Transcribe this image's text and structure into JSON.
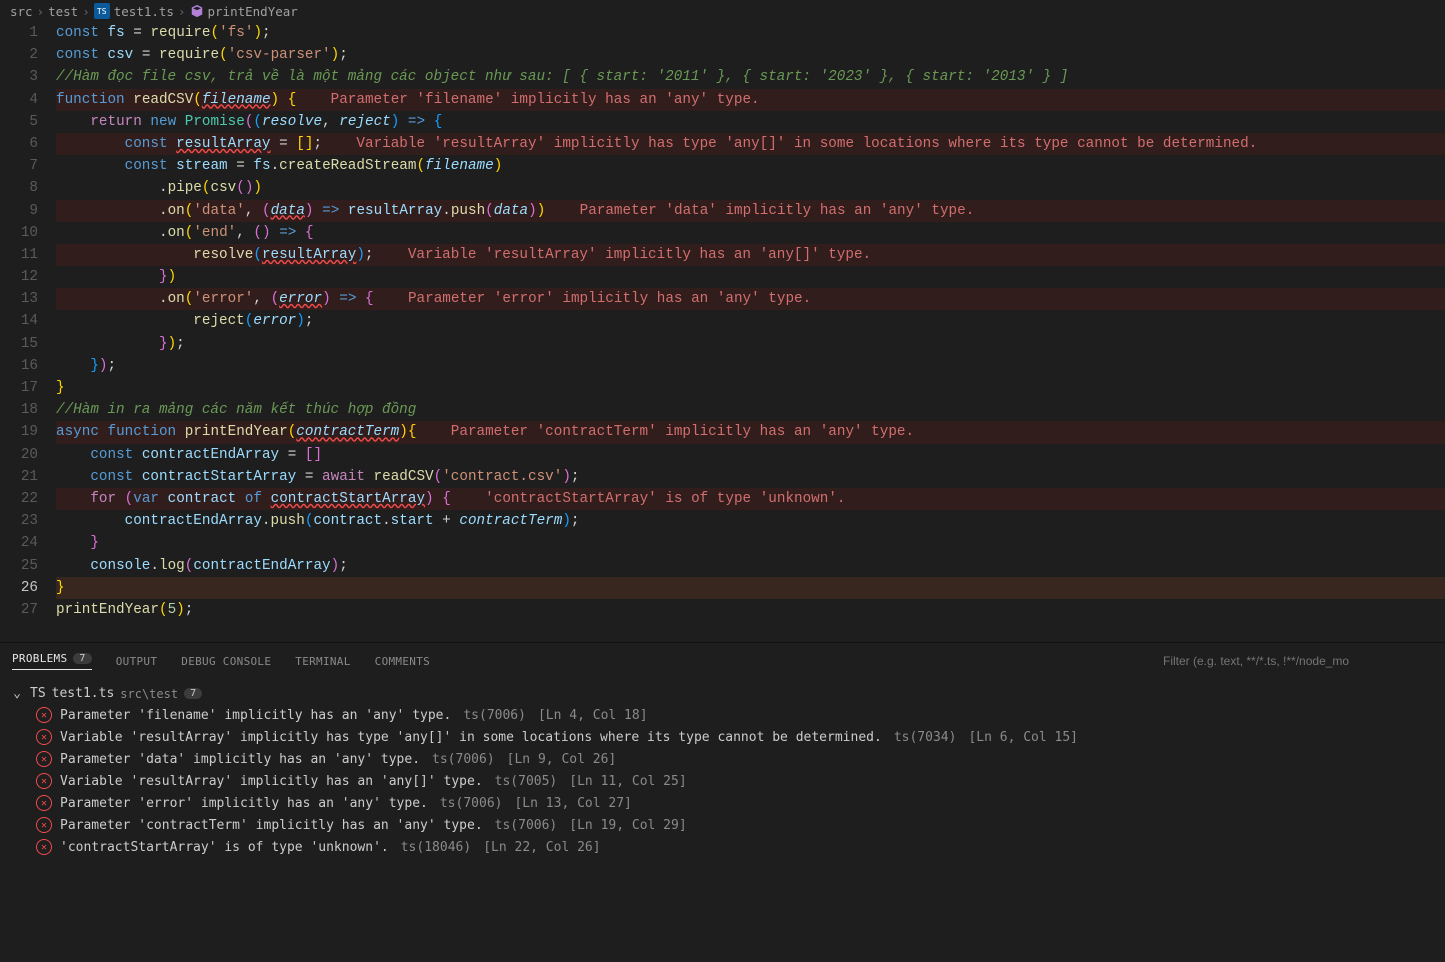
{
  "breadcrumb": {
    "parts": [
      "src",
      "test",
      "test1.ts",
      "printEndYear"
    ]
  },
  "editor": {
    "active_line": 26,
    "lines": [
      {
        "n": 1,
        "err": false,
        "html": "<span class='kw'>const</span> <span class='var'>fs</span> <span class='op'>=</span> <span class='fn'>require</span><span class='brace'>(</span><span class='str'>'fs'</span><span class='brace'>)</span><span class='punc'>;</span>"
      },
      {
        "n": 2,
        "err": false,
        "html": "<span class='kw'>const</span> <span class='var'>csv</span> <span class='op'>=</span> <span class='fn'>require</span><span class='brace'>(</span><span class='str'>'csv-parser'</span><span class='brace'>)</span><span class='punc'>;</span>"
      },
      {
        "n": 3,
        "err": false,
        "html": "<span class='cm'>//Hàm đọc file csv, trả về là một mảng các object như sau: [ { start: '2011' }, { start: '2023' }, { start: '2013' } ]</span>"
      },
      {
        "n": 4,
        "err": true,
        "html": "<span class='kw'>function</span> <span class='fn'>readCSV</span><span class='brace'>(</span><span class='param squig'>filename</span><span class='brace'>)</span> <span class='brace'>{</span>    <span class='hint'>Parameter 'filename' implicitly has an 'any' type.</span>"
      },
      {
        "n": 5,
        "err": false,
        "html": "    <span class='kw2'>return</span> <span class='kw'>new</span> <span class='cls'>Promise</span><span class='brace2'>(</span><span class='brace3'>(</span><span class='param'>resolve</span><span class='punc'>,</span> <span class='param'>reject</span><span class='brace3'>)</span> <span class='kw'>=&gt;</span> <span class='brace3'>{</span>"
      },
      {
        "n": 6,
        "err": true,
        "html": "        <span class='kw'>const</span> <span class='var squig'>resultArray</span> <span class='op'>=</span> <span class='brace'>[</span><span class='brace'>]</span><span class='punc'>;</span>    <span class='hint'>Variable 'resultArray' implicitly has type 'any[]' in some locations where its type cannot be determined.</span>"
      },
      {
        "n": 7,
        "err": false,
        "html": "        <span class='kw'>const</span> <span class='var'>stream</span> <span class='op'>=</span> <span class='var'>fs</span><span class='punc'>.</span><span class='fn'>createReadStream</span><span class='brace'>(</span><span class='param'>filename</span><span class='brace'>)</span>"
      },
      {
        "n": 8,
        "err": false,
        "html": "            <span class='punc'>.</span><span class='fn'>pipe</span><span class='brace'>(</span><span class='fn'>csv</span><span class='brace2'>(</span><span class='brace2'>)</span><span class='brace'>)</span>"
      },
      {
        "n": 9,
        "err": true,
        "html": "            <span class='punc'>.</span><span class='fn'>on</span><span class='brace'>(</span><span class='str'>'data'</span><span class='punc'>,</span> <span class='brace2'>(</span><span class='param squig'>data</span><span class='brace2'>)</span> <span class='kw'>=&gt;</span> <span class='var'>resultArray</span><span class='punc'>.</span><span class='fn'>push</span><span class='brace2'>(</span><span class='param'>data</span><span class='brace2'>)</span><span class='brace'>)</span>    <span class='hint'>Parameter 'data' implicitly has an 'any' type.</span>"
      },
      {
        "n": 10,
        "err": false,
        "html": "            <span class='punc'>.</span><span class='fn'>on</span><span class='brace'>(</span><span class='str'>'end'</span><span class='punc'>,</span> <span class='brace2'>(</span><span class='brace2'>)</span> <span class='kw'>=&gt;</span> <span class='brace2'>{</span>"
      },
      {
        "n": 11,
        "err": true,
        "html": "                <span class='fn'>resolve</span><span class='brace3'>(</span><span class='var squig'>resultArray</span><span class='brace3'>)</span><span class='punc'>;</span>    <span class='hint'>Variable 'resultArray' implicitly has an 'any[]' type.</span>"
      },
      {
        "n": 12,
        "err": false,
        "html": "            <span class='brace2'>}</span><span class='brace'>)</span>"
      },
      {
        "n": 13,
        "err": true,
        "html": "            <span class='punc'>.</span><span class='fn'>on</span><span class='brace'>(</span><span class='str'>'error'</span><span class='punc'>,</span> <span class='brace2'>(</span><span class='param squig'>error</span><span class='brace2'>)</span> <span class='kw'>=&gt;</span> <span class='brace2'>{</span>    <span class='hint'>Parameter 'error' implicitly has an 'any' type.</span>"
      },
      {
        "n": 14,
        "err": false,
        "html": "                <span class='fn'>reject</span><span class='brace3'>(</span><span class='param'>error</span><span class='brace3'>)</span><span class='punc'>;</span>"
      },
      {
        "n": 15,
        "err": false,
        "html": "            <span class='brace2'>}</span><span class='brace'>)</span><span class='punc'>;</span>"
      },
      {
        "n": 16,
        "err": false,
        "html": "    <span class='brace3'>}</span><span class='brace2'>)</span><span class='punc'>;</span>"
      },
      {
        "n": 17,
        "err": false,
        "html": "<span class='brace'>}</span>"
      },
      {
        "n": 18,
        "err": false,
        "html": "<span class='cm'>//Hàm in ra mảng các năm kết thúc hợp đồng</span>"
      },
      {
        "n": 19,
        "err": true,
        "html": "<span class='kw'>async</span> <span class='kw'>function</span> <span class='fn'>printEndYear</span><span class='brace'>(</span><span class='param squig'>contractTerm</span><span class='brace'>)</span><span class='brace'>{</span>    <span class='hint'>Parameter 'contractTerm' implicitly has an 'any' type.</span>"
      },
      {
        "n": 20,
        "err": false,
        "html": "    <span class='kw'>const</span> <span class='var'>contractEndArray</span> <span class='op'>=</span> <span class='brace2'>[</span><span class='brace2'>]</span>"
      },
      {
        "n": 21,
        "err": false,
        "html": "    <span class='kw'>const</span> <span class='var'>contractStartArray</span> <span class='op'>=</span> <span class='kw2'>await</span> <span class='fn'>readCSV</span><span class='brace2'>(</span><span class='str'>'contract.csv'</span><span class='brace2'>)</span><span class='punc'>;</span>"
      },
      {
        "n": 22,
        "err": true,
        "html": "    <span class='kw2'>for</span> <span class='brace2'>(</span><span class='kw'>var</span> <span class='var'>contract</span> <span class='kw'>of</span> <span class='var squig'>contractStartArray</span><span class='brace2'>)</span> <span class='brace2'>{</span>    <span class='hint'>'contractStartArray' is of type 'unknown'.</span>"
      },
      {
        "n": 23,
        "err": false,
        "html": "        <span class='var'>contractEndArray</span><span class='punc'>.</span><span class='fn'>push</span><span class='brace3'>(</span><span class='var'>contract</span><span class='punc'>.</span><span class='var'>start</span> <span class='op'>+</span> <span class='param'>contractTerm</span><span class='brace3'>)</span><span class='punc'>;</span>"
      },
      {
        "n": 24,
        "err": false,
        "html": "    <span class='brace2'>}</span>"
      },
      {
        "n": 25,
        "err": false,
        "html": "    <span class='var'>console</span><span class='punc'>.</span><span class='fn'>log</span><span class='brace2'>(</span><span class='var'>contractEndArray</span><span class='brace2'>)</span><span class='punc'>;</span>"
      },
      {
        "n": 26,
        "err": false,
        "sel": true,
        "html": "<span class='brace'>}</span>"
      },
      {
        "n": 27,
        "err": false,
        "html": "<span class='fn'>printEndYear</span><span class='brace'>(</span><span class='num'>5</span><span class='brace'>)</span><span class='punc'>;</span>"
      }
    ]
  },
  "panel": {
    "tabs": [
      {
        "label": "PROBLEMS",
        "active": true,
        "badge": "7"
      },
      {
        "label": "OUTPUT",
        "active": false
      },
      {
        "label": "DEBUG CONSOLE",
        "active": false
      },
      {
        "label": "TERMINAL",
        "active": false
      },
      {
        "label": "COMMENTS",
        "active": false
      }
    ],
    "filter_placeholder": "Filter (e.g. text, **/*.ts, !**/node_mo",
    "file": {
      "name": "test1.ts",
      "path": "src\\test",
      "count": "7"
    },
    "items": [
      {
        "msg": "Parameter 'filename' implicitly has an 'any' type.",
        "code": "ts(7006)",
        "loc": "[Ln 4, Col 18]"
      },
      {
        "msg": "Variable 'resultArray' implicitly has type 'any[]' in some locations where its type cannot be determined.",
        "code": "ts(7034)",
        "loc": "[Ln 6, Col 15]"
      },
      {
        "msg": "Parameter 'data' implicitly has an 'any' type.",
        "code": "ts(7006)",
        "loc": "[Ln 9, Col 26]"
      },
      {
        "msg": "Variable 'resultArray' implicitly has an 'any[]' type.",
        "code": "ts(7005)",
        "loc": "[Ln 11, Col 25]"
      },
      {
        "msg": "Parameter 'error' implicitly has an 'any' type.",
        "code": "ts(7006)",
        "loc": "[Ln 13, Col 27]"
      },
      {
        "msg": "Parameter 'contractTerm' implicitly has an 'any' type.",
        "code": "ts(7006)",
        "loc": "[Ln 19, Col 29]"
      },
      {
        "msg": "'contractStartArray' is of type 'unknown'.",
        "code": "ts(18046)",
        "loc": "[Ln 22, Col 26]"
      }
    ]
  }
}
